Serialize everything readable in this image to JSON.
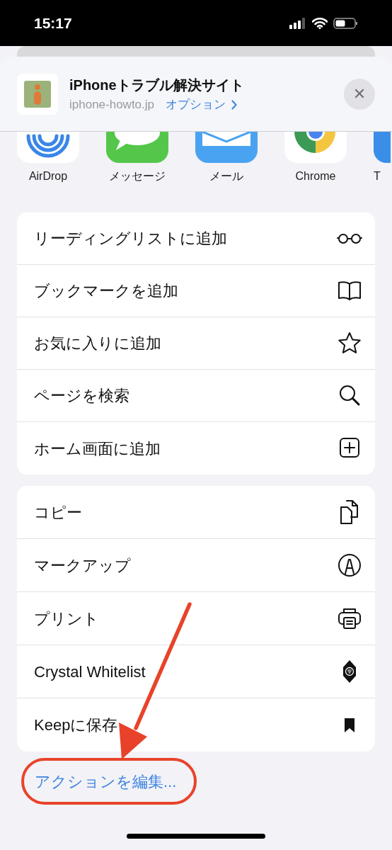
{
  "status_bar": {
    "time": "15:17"
  },
  "share_header": {
    "title": "iPhoneトラブル解決サイト",
    "domain": "iphone-howto.jp",
    "options_link": "オプション",
    "close_glyph": "✕"
  },
  "apps": [
    {
      "label": "AirDrop"
    },
    {
      "label": "メッセージ"
    },
    {
      "label": "メール"
    },
    {
      "label": "Chrome"
    },
    {
      "label": "T"
    }
  ],
  "action_groups": [
    {
      "items": [
        {
          "label": "リーディングリストに追加"
        },
        {
          "label": "ブックマークを追加"
        },
        {
          "label": "お気に入りに追加"
        },
        {
          "label": "ページを検索"
        },
        {
          "label": "ホーム画面に追加"
        }
      ]
    },
    {
      "items": [
        {
          "label": "コピー"
        },
        {
          "label": "マークアップ"
        },
        {
          "label": "プリント"
        },
        {
          "label": "Crystal Whitelist"
        },
        {
          "label": "Keepに保存"
        }
      ]
    }
  ],
  "edit_actions_link": "アクションを編集..."
}
